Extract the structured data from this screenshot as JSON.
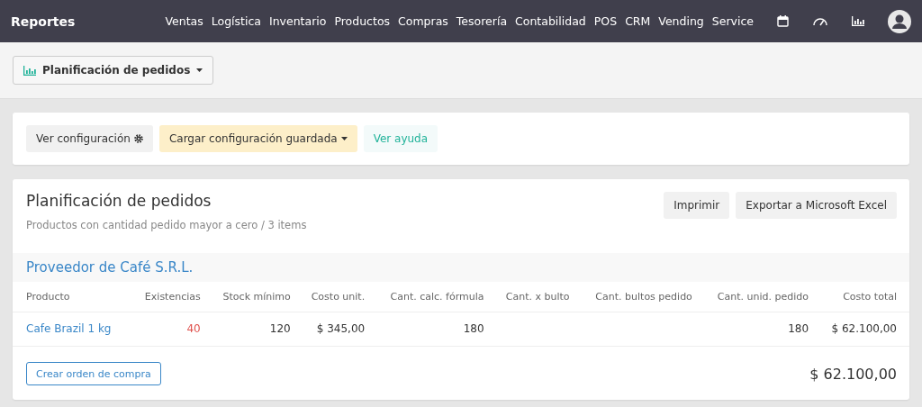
{
  "navbar": {
    "brand": "Reportes",
    "items": [
      "Ventas",
      "Logística",
      "Inventario",
      "Productos",
      "Compras",
      "Tesorería",
      "Contabilidad",
      "POS",
      "CRM",
      "Vending",
      "Service"
    ]
  },
  "report_selector": {
    "label": "Planificación de pedidos"
  },
  "config_bar": {
    "view_config": "Ver configuración",
    "load_saved": "Cargar configuración guardada",
    "help": "Ver ayuda"
  },
  "report": {
    "title": "Planificación de pedidos",
    "subtitle": "Productos con cantidad pedido mayor a cero / 3 items",
    "actions": [
      "Imprimir",
      "Exportar a Microsoft Excel"
    ],
    "supplier": "Proveedor de Café S.R.L.",
    "columns": [
      "Producto",
      "Existencias",
      "Stock mínimo",
      "Costo unit.",
      "Cant. calc. fórmula",
      "Cant. x bulto",
      "Cant. bultos pedido",
      "Cant. unid. pedido",
      "Costo total"
    ],
    "rows": [
      {
        "cells": [
          "Cafe Brazil 1 kg",
          "40",
          "120",
          "$ 345,00",
          "180",
          "",
          "",
          "180",
          "$ 62.100,00"
        ],
        "low_stock": true
      }
    ],
    "create_order": "Crear orden de compra",
    "total": "$ 62.100,00"
  }
}
